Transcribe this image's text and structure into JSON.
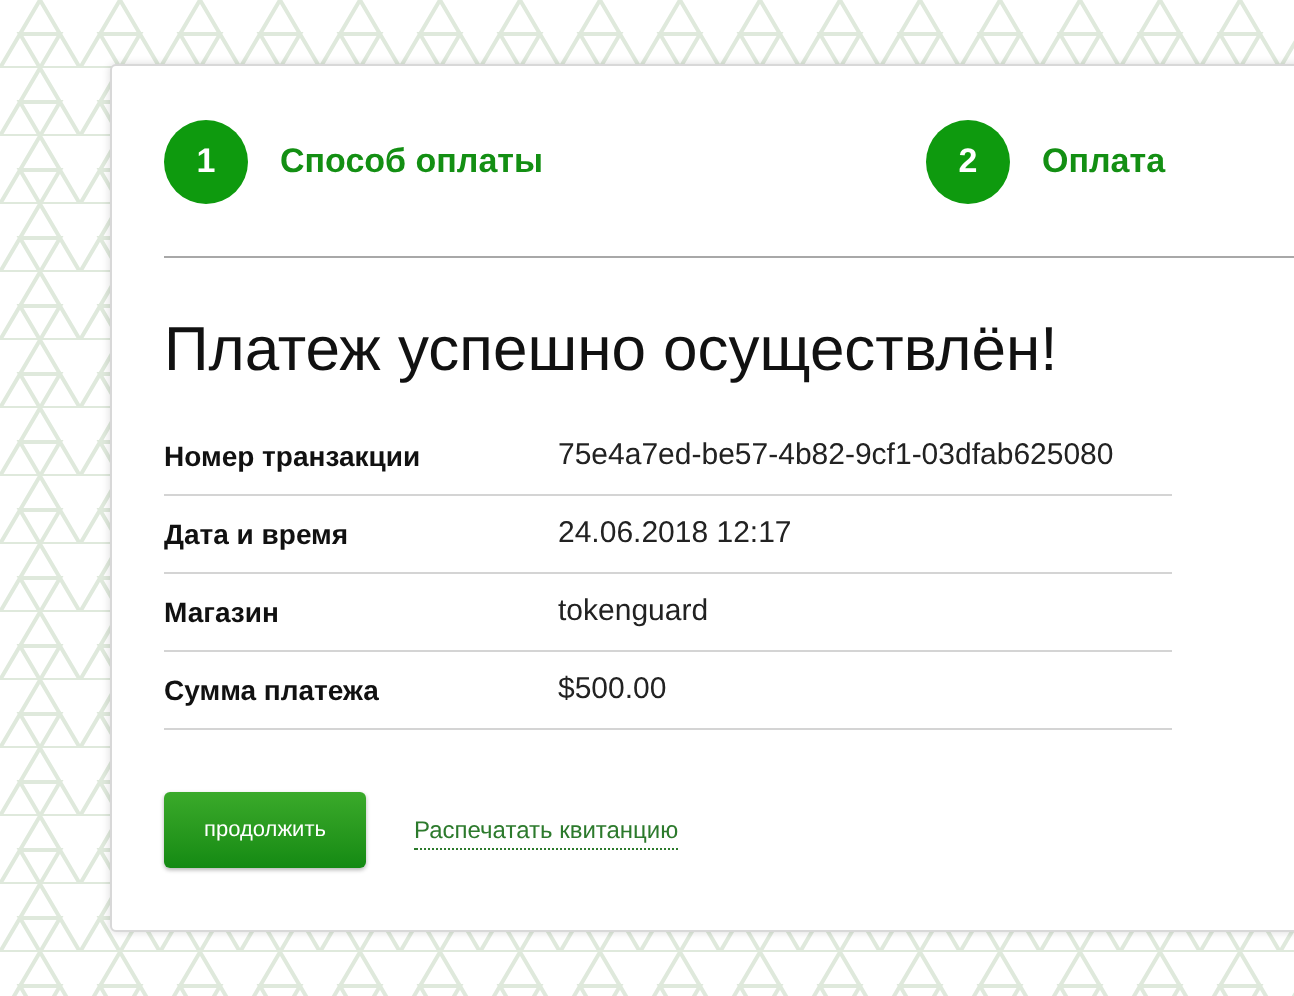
{
  "steps": [
    {
      "number": "1",
      "label": "Способ оплаты"
    },
    {
      "number": "2",
      "label": "Оплата"
    }
  ],
  "title": "Платеж успешно осуществлён!",
  "details": [
    {
      "label": "Номер транзакции",
      "value": "75e4a7ed-be57-4b82-9cf1-03dfab625080"
    },
    {
      "label": "Дата и время",
      "value": "24.06.2018 12:17"
    },
    {
      "label": "Магазин",
      "value": "tokenguard"
    },
    {
      "label": "Сумма платежа",
      "value": "$500.00"
    }
  ],
  "continue_button": "продолжить",
  "print_link": "Распечатать квитанцию"
}
